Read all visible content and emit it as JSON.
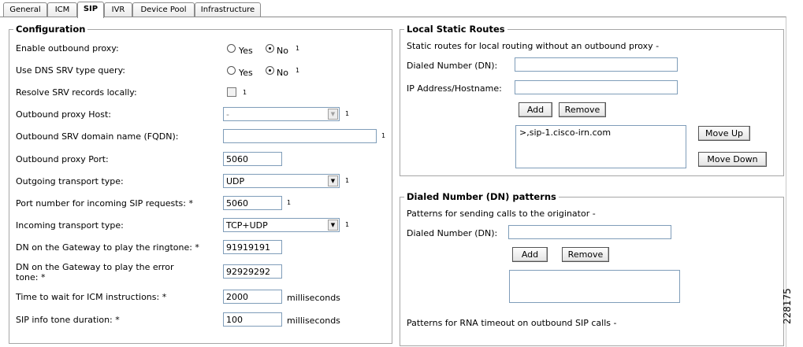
{
  "tabs": [
    "General",
    "ICM",
    "SIP",
    "IVR",
    "Device Pool",
    "Infrastructure"
  ],
  "configuration": {
    "legend": "Configuration",
    "yes_label": "Yes",
    "no_label": "No",
    "footnote": "1",
    "enable_outbound_proxy": {
      "label": "Enable outbound proxy:",
      "selected": "No"
    },
    "use_dns_srv": {
      "label": "Use DNS SRV type query:",
      "selected": "No"
    },
    "resolve_srv": {
      "label": "Resolve SRV records locally:",
      "checked": false
    },
    "outbound_proxy_host": {
      "label": "Outbound proxy Host:",
      "value": "-"
    },
    "outbound_srv_domain": {
      "label": "Outbound SRV domain name (FQDN):",
      "value": ""
    },
    "outbound_proxy_port": {
      "label": "Outbound proxy Port:",
      "value": "5060"
    },
    "outgoing_transport": {
      "label": "Outgoing transport type:",
      "value": "UDP"
    },
    "incoming_port": {
      "label": "Port number for incoming SIP requests: *",
      "value": "5060"
    },
    "incoming_transport": {
      "label": "Incoming transport type:",
      "value": "TCP+UDP"
    },
    "ringtone_dn": {
      "label": "DN on the Gateway to play the ringtone: *",
      "value": "91919191"
    },
    "error_tone_dn": {
      "label": "DN on the Gateway to play the error tone: *",
      "value": "92929292"
    },
    "icm_wait": {
      "label": "Time to wait for ICM instructions: *",
      "value": "2000",
      "unit": "milliseconds"
    },
    "sip_info_tone": {
      "label": "SIP info tone duration: *",
      "value": "100",
      "unit": "milliseconds"
    }
  },
  "local_static_routes": {
    "legend": "Local Static Routes",
    "description": "Static routes for local routing without an outbound proxy -",
    "dialed_number_label": "Dialed Number (DN):",
    "dialed_number_value": "",
    "ip_label": "IP Address/Hostname:",
    "ip_value": "",
    "add_label": "Add",
    "remove_label": "Remove",
    "routes": [
      ">,sip-1.cisco-irn.com"
    ],
    "move_up_label": "Move Up",
    "move_down_label": "Move Down"
  },
  "dn_patterns": {
    "legend": "Dialed Number (DN) patterns",
    "description": "Patterns for sending calls to the originator -",
    "dialed_number_label": "Dialed Number (DN):",
    "dialed_number_value": "",
    "add_label": "Add",
    "remove_label": "Remove",
    "rna_description": "Patterns for RNA timeout on outbound SIP calls -"
  },
  "figure_id": "228175"
}
